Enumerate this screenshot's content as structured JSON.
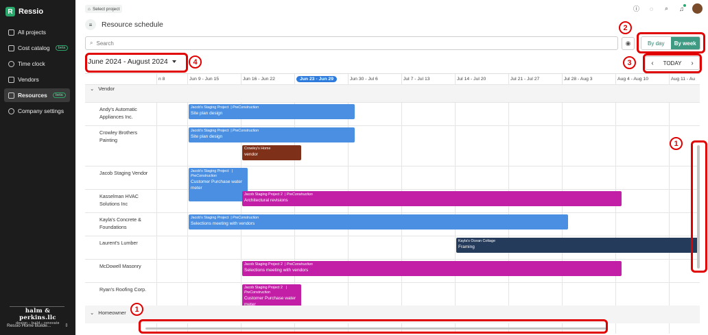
{
  "app": {
    "name": "Ressio",
    "logo_letter": "R"
  },
  "sidebar": {
    "items": [
      {
        "label": "All projects",
        "icon": "home-icon",
        "beta": ""
      },
      {
        "label": "Cost catalog",
        "icon": "catalog-icon",
        "beta": "beta"
      },
      {
        "label": "Time clock",
        "icon": "clock-icon",
        "beta": ""
      },
      {
        "label": "Vendors",
        "icon": "truck-icon",
        "beta": ""
      },
      {
        "label": "Resources",
        "icon": "list-icon",
        "beta": "beta",
        "active": true
      },
      {
        "label": "Company settings",
        "icon": "gear-icon",
        "beta": ""
      }
    ],
    "company_name": "halm & perkins.llc",
    "company_tagline": "design - build - renovate",
    "account": "Ressio Home Builde..."
  },
  "topbar": {
    "breadcrumb": "Select project",
    "icons": [
      "info-icon",
      "chat-icon",
      "search-icon",
      "bell-icon",
      "avatar"
    ]
  },
  "page": {
    "title": "Resource schedule",
    "search_placeholder": "Search",
    "toggle": {
      "by_day": "By day",
      "by_week": "By week",
      "selected": "By week"
    },
    "date_range": "June 2024 - August 2024",
    "today": "TODAY",
    "prev": "‹",
    "next": "›"
  },
  "callouts": [
    "1",
    "2",
    "3",
    "4",
    "1"
  ],
  "colors": {
    "accent": "#3e9a82",
    "blue": "#4a8fe2",
    "brown": "#7e3018",
    "magenta": "#c31ea6",
    "navy": "#253b5c",
    "callout": "#e00000"
  },
  "schedule": {
    "weeks": [
      "n 8",
      "Jun 9 - Jun 15",
      "Jun 16 - Jun 22",
      "Jun 23 - Jun 29",
      "Jun 30 - Jul 6",
      "Jul 7 - Jul 13",
      "Jul 14 - Jul 20",
      "Jul 21 - Jul 27",
      "Jul 28 - Aug 3",
      "Aug 4 - Aug 10",
      "Aug 11 - Au"
    ],
    "current_week_index": 3,
    "groups": [
      "Vendor",
      "Homeowner"
    ],
    "vendors": [
      "Andy's Automatic Appliances Inc.",
      "Crowley Brothers Painting",
      "Jacob Staging Vendor",
      "Kasselman HVAC Solutions Inc",
      "Kayla's Concrete & Foundations",
      "Laurent's Lumber",
      "McDowell Masonry",
      "Ryan's Roofing Corp."
    ],
    "tasks": [
      {
        "project": "Jacob's Staging Project",
        "phase": "| PreConstruction",
        "task": "Site plan design",
        "color": "blue"
      },
      {
        "project": "Jacob's Staging Project",
        "phase": "| PreConstruction",
        "task": "Site plan design",
        "color": "blue"
      },
      {
        "project": "Crowley's Home",
        "phase": "",
        "task": "vendor",
        "color": "brown"
      },
      {
        "project": "Jacob's Staging Project",
        "phase": "| PreConstruction",
        "task": "Customer Purchase water meter",
        "color": "blue"
      },
      {
        "project": "Jacob Staging Project 2",
        "phase": "| PreConstruction",
        "task": "Architectural revisions",
        "color": "magenta"
      },
      {
        "project": "Jacob's Staging Project",
        "phase": "| PreConstruction",
        "task": "Selections meeting with vendors",
        "color": "blue"
      },
      {
        "project": "Kayla's Ocean Cottage",
        "phase": "",
        "task": "Framing",
        "color": "navy"
      },
      {
        "project": "Jacob Staging Project 2",
        "phase": "| PreConstruction",
        "task": "Selections meeting with vendors",
        "color": "magenta"
      },
      {
        "project": "Jacob Staging Project 2",
        "phase": "| PreConstruction",
        "task": "Customer Purchase water meter",
        "color": "magenta"
      }
    ]
  }
}
